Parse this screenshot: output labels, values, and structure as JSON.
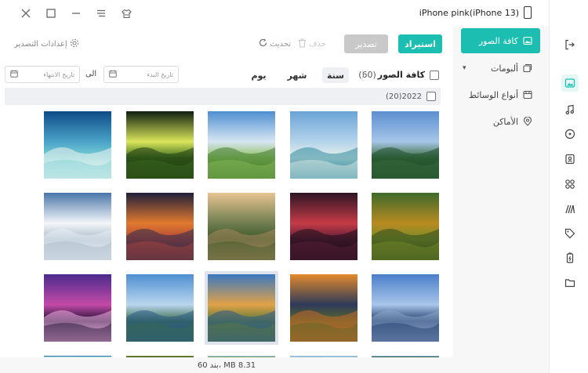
{
  "device": {
    "name": "iPhone pink(iPhone 13)"
  },
  "nav": {
    "items": [
      {
        "label": "كافة الصور",
        "icon": "photo-icon",
        "active": true
      },
      {
        "label": "ألبومات",
        "icon": "album-icon",
        "active": false
      },
      {
        "label": "أنواع الوسائط",
        "icon": "media-types-icon",
        "active": false
      },
      {
        "label": "الأماكن",
        "icon": "location-pin-icon",
        "active": false
      }
    ]
  },
  "iconbar": {
    "items": [
      "sign-out-icon",
      "photos-icon",
      "music-icon",
      "video-icon",
      "contacts-icon",
      "apps-icon",
      "books-icon",
      "tag-icon",
      "battery-icon",
      "folder-icon"
    ]
  },
  "toolbar": {
    "import_label": "استيراد",
    "export_label": "تصدير",
    "delete_label": "حذف",
    "refresh_label": "تحديث",
    "export_settings_label": "إعدادات التصدير"
  },
  "filter": {
    "all_photos_label": "كافة الصور",
    "all_photos_count": "(60)",
    "year_label": "سنة",
    "month_label": "شهر",
    "day_label": "يوم",
    "start_date_placeholder": "تاريخ البدء",
    "to_label": "الى",
    "end_date_placeholder": "تاريخ الانتهاء"
  },
  "group": {
    "year": "2022",
    "count": "(20)"
  },
  "photos": [
    {
      "name": "mountain-lake-valley",
      "colors": [
        "#5b8fd0",
        "#a6c6e8",
        "#3a6b3a",
        "#1e4d2b"
      ]
    },
    {
      "name": "white-sand-beach",
      "colors": [
        "#6aa3d6",
        "#b4d4ea",
        "#e9efe9",
        "#2d8a9e"
      ]
    },
    {
      "name": "green-hills-clouds",
      "colors": [
        "#4f8fd1",
        "#d7e6f2",
        "#8cbc5c",
        "#3f7a2e"
      ]
    },
    {
      "name": "lone-tree-sunlight",
      "colors": [
        "#0f1f10",
        "#d9e55a",
        "#3c6b1e",
        "#1e3a12"
      ]
    },
    {
      "name": "tropical-sea-shore",
      "colors": [
        "#0e4b86",
        "#4aa3c8",
        "#7ed2d6",
        "#f1f4f1"
      ]
    },
    {
      "name": "autumn-mountain-forest",
      "colors": [
        "#3d6a2b",
        "#b88a22",
        "#7a8c28",
        "#2e4a1e"
      ]
    },
    {
      "name": "red-sky-lake",
      "colors": [
        "#2d1424",
        "#c43b46",
        "#5d1e3a",
        "#1a0f18"
      ]
    },
    {
      "name": "forest-sunset-valley",
      "colors": [
        "#e8c492",
        "#6f7d4f",
        "#3e5a2a",
        "#a6875d"
      ]
    },
    {
      "name": "sunset-sea-reflection",
      "colors": [
        "#1e1f3a",
        "#e07a2e",
        "#b2453a",
        "#2a2c4a"
      ]
    },
    {
      "name": "snowy-rocks",
      "colors": [
        "#4a76a8",
        "#f3f6f9",
        "#a9b9c8",
        "#e5ecf2"
      ]
    },
    {
      "name": "calm-sea-sunrise",
      "colors": [
        "#4a7ec8",
        "#a9c6ea",
        "#1e3a6a",
        "#8aa6c8"
      ]
    },
    {
      "name": "sunset-hills-field",
      "colors": [
        "#e38a2c",
        "#2e3a5a",
        "#5a6a2a",
        "#c4662a"
      ]
    },
    {
      "name": "lake-village-reflection",
      "colors": [
        "#3a78c0",
        "#e0a248",
        "#5a7a3a",
        "#2e5a8a"
      ]
    },
    {
      "name": "mountain-fjord-reflection",
      "colors": [
        "#4f8fd1",
        "#b9d6ee",
        "#3a6a4a",
        "#2a5a8a"
      ]
    },
    {
      "name": "purple-sunset-rock",
      "colors": [
        "#4a2a8a",
        "#c44aa8",
        "#1a1030",
        "#f0b0e0"
      ]
    }
  ],
  "status": {
    "text": "60 بند، MB 8.31"
  },
  "colors": {
    "accent": "#1bbeb0",
    "nav_bg": "#f7f7f7",
    "disabled": "#c9c9c9"
  }
}
